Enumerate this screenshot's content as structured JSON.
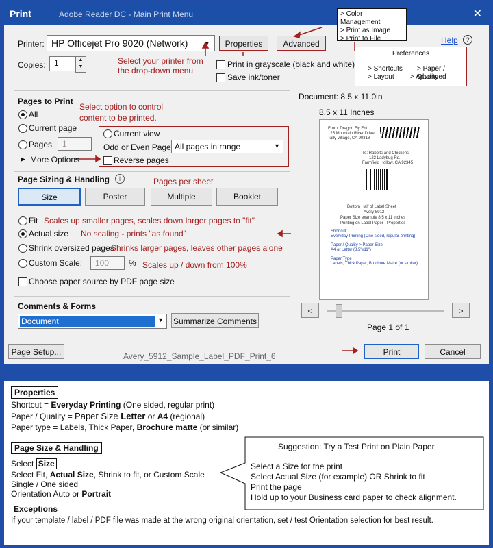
{
  "window": {
    "title": "Print",
    "subtitle": "Adobe Reader DC - Main Print Menu",
    "close_glyph": "✕"
  },
  "printer": {
    "label": "Printer:",
    "value": "HP Officejet Pro 9020 (Network)",
    "properties_label": "Properties",
    "advanced_label": "Advanced",
    "help_label": "Help",
    "help_glyph": "?"
  },
  "copies": {
    "label": "Copies:",
    "value": "1"
  },
  "options": {
    "grayscale_label": "Print in grayscale (black and white)",
    "save_ink_label": "Save ink/toner"
  },
  "annotations": {
    "select_printer": [
      "Select your printer from",
      "the drop-down menu"
    ],
    "advanced_menu": [
      "> Color Management",
      "> Print as Image",
      "> Print to File"
    ],
    "preferences": {
      "title": "Preferences",
      "items": [
        "> Shortcuts",
        "> Paper / Quality",
        "> Layout",
        "> Advanced"
      ]
    },
    "select_content": [
      "Select option to control",
      "content to be printed."
    ],
    "pages_per_sheet": "Pages per sheet",
    "fit_note": "Scales up smaller pages, scales down larger pages to \"fit\"",
    "actual_note": "No scaling - prints \"as found\"",
    "shrink_note": "Shrinks larger pages, leaves other pages alone",
    "custom_note": "Scales up / down from 100%"
  },
  "pages_to_print": {
    "heading": "Pages to Print",
    "all": "All",
    "current_page": "Current page",
    "pages": "Pages",
    "pages_value": "1",
    "more_options": "More Options",
    "current_view": "Current view",
    "odd_even_label": "Odd or Even Pages:",
    "odd_even_value": "All pages in range",
    "reverse": "Reverse pages"
  },
  "sizing": {
    "heading": "Page Sizing & Handling",
    "tabs": [
      "Size",
      "Poster",
      "Multiple",
      "Booklet"
    ],
    "fit": "Fit",
    "actual": "Actual size",
    "shrink": "Shrink oversized pages",
    "custom": "Custom Scale:",
    "custom_value": "100",
    "percent": "%",
    "paper_source": "Choose paper source by PDF page size"
  },
  "comments": {
    "heading": "Comments & Forms",
    "value": "Document",
    "summarize": "Summarize Comments"
  },
  "preview": {
    "document_size": "Document: 8.5 x 11.0in",
    "paper_size": "8.5 x 11 Inches",
    "page_text": "Page 1 of 1",
    "prev_glyph": "<",
    "next_glyph": ">",
    "thumb": {
      "from": [
        "From: Dragon Fly Ent.",
        "125 Mountain River Drive",
        "Tally Village, CA 90318"
      ],
      "to": [
        "To: Rabbits and Chickens",
        "123 Ladybug Rd.",
        "Farmfield Hollow, CA 92345"
      ],
      "lines": [
        "Bottom Half of Label Sheet",
        "Avery 5912",
        "Paper Size example 8.5 x 11 inches",
        "Printing on Label Paper - Properties"
      ],
      "shortcut": [
        "Shortcut",
        "Everyday Printing (One sided, regular printing)"
      ],
      "paper_q": [
        "Paper / Quality > Paper Size",
        "A4 or Letter (8.5\"x11\")"
      ],
      "ptype": [
        "Paper Type",
        "Labels, Thick Paper, Brochure Matte (or similar)"
      ]
    }
  },
  "footer": {
    "page_setup": "Page Setup...",
    "filename": "Avery_5912_Sample_Label_PDF_Print_6",
    "print": "Print",
    "cancel": "Cancel"
  },
  "notes": {
    "properties": {
      "title": "Properties",
      "line1_a": "Shortcut = ",
      "line1_b": "Everyday Printing",
      "line1_c": " (One sided, regular print)",
      "line2_a": "Paper / Quality = ",
      "line2_b": "Paper Size ",
      "line2_c": "Letter",
      "line2_d": " or ",
      "line2_e": "A4",
      "line2_f": " (regional)",
      "line3_a": "Paper type = Labels, Thick Paper, ",
      "line3_b": "Brochure matte",
      "line3_c": " (or similar)"
    },
    "size_handling": {
      "title": "Page Size & Handling",
      "select_a": "Select ",
      "select_b": "Size",
      "line2_a": "Select Fit, ",
      "line2_b": "Actual Size",
      "line2_c": ", Shrink to fit, or Custom Scale",
      "line3": "Single / One sided",
      "line4_a": "Orientation Auto or ",
      "line4_b": "Portrait"
    },
    "suggestion": {
      "title": "Suggestion:  Try a Test Print on Plain Paper",
      "steps": [
        "Select a Size for the print",
        "Select Actual Size (for example) OR Shrink to fit",
        "Print the page",
        "Hold up to your Business card paper to check alignment."
      ]
    },
    "exceptions": {
      "title": "Exceptions",
      "text": "If your template / label / PDF file was made at the wrong original orientation, set / test Orientation selection for best result."
    }
  }
}
